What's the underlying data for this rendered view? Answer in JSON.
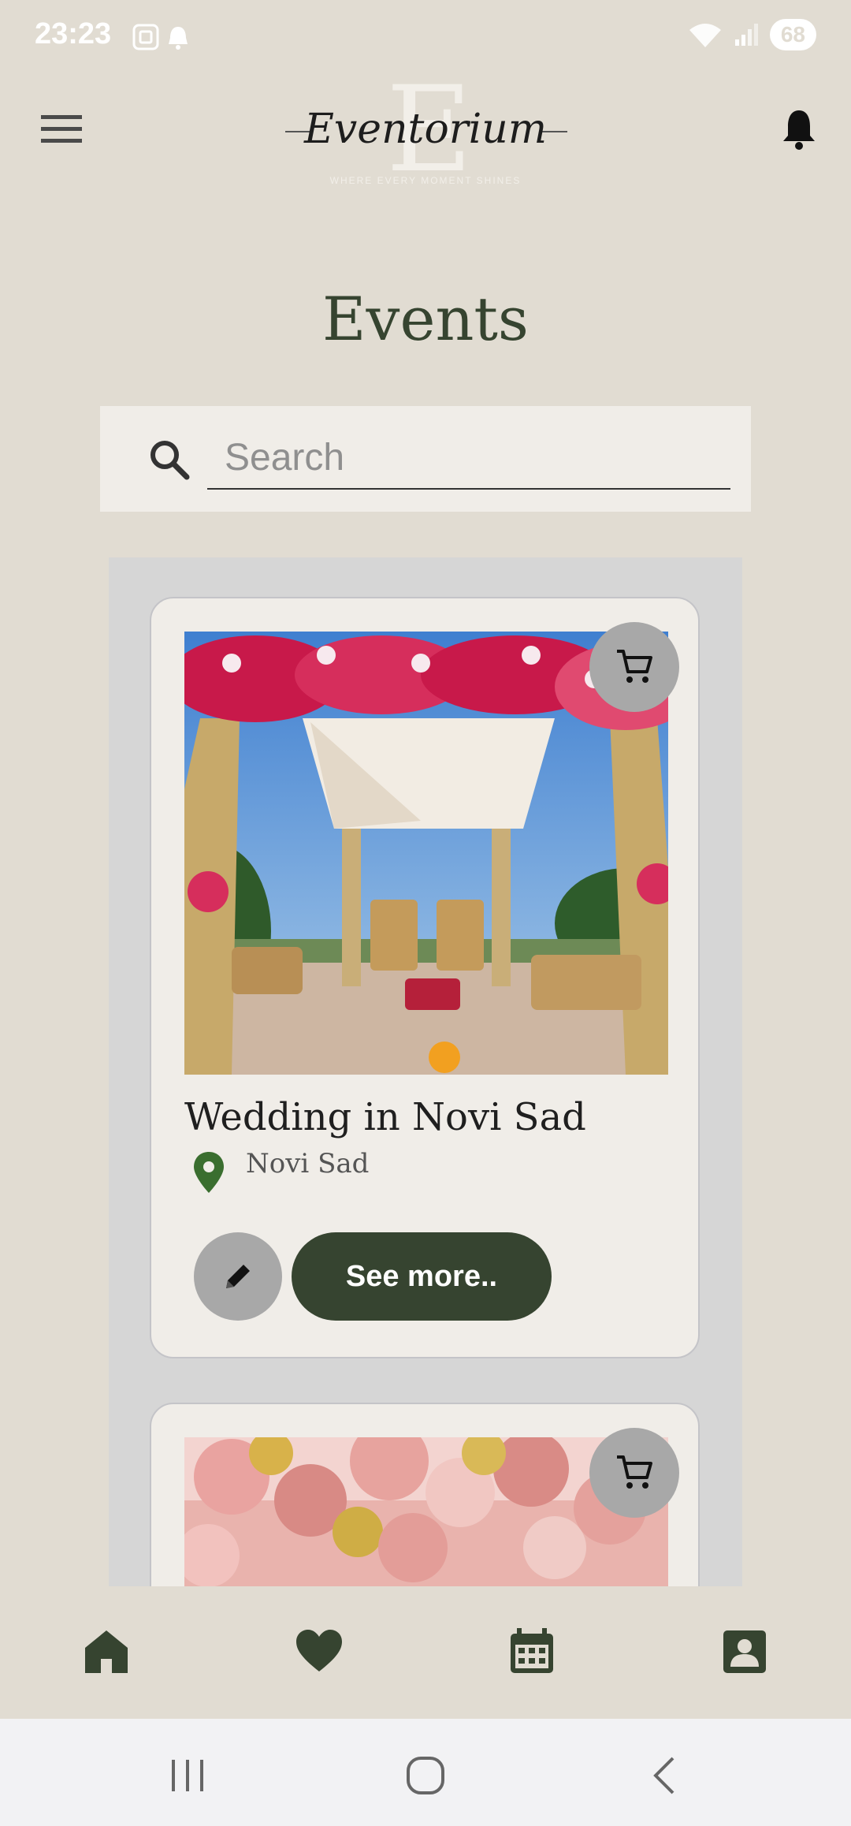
{
  "status_bar": {
    "time": "23:23",
    "battery": "68"
  },
  "header": {
    "logo_letter": "E",
    "logo_text": "Eventorium",
    "logo_tagline": "WHERE EVERY MOMENT SHINES"
  },
  "page": {
    "title": "Events"
  },
  "search": {
    "placeholder": "Search",
    "value": ""
  },
  "events": [
    {
      "title": "Wedding in Novi Sad",
      "location": "Novi Sad",
      "button_label": "See more.."
    }
  ],
  "bottom_nav": {
    "items": [
      "home-icon",
      "heart-icon",
      "calendar-icon",
      "contact-icon"
    ],
    "active_color": "#364430"
  },
  "colors": {
    "background": "#e1dcd2",
    "primary": "#364430",
    "card": "#f0ede8",
    "icon_button": "#a8a8a8"
  }
}
